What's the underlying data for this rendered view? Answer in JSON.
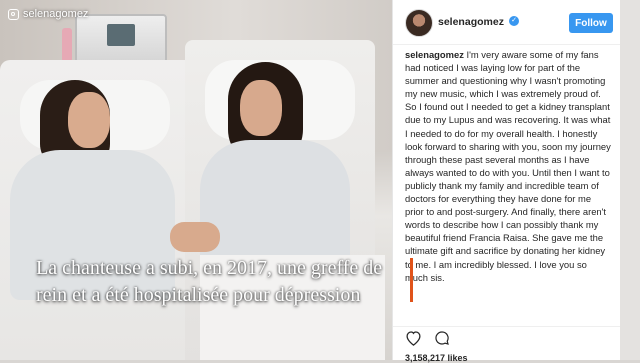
{
  "photo": {
    "handle": "selenagomez",
    "handle_icon": "instagram-icon"
  },
  "post": {
    "username": "selenagomez",
    "follow_label": "Follow",
    "caption_username": "selenagomez",
    "caption_text": " I'm very aware some of my fans had noticed I was laying low for part of the summer and questioning why I wasn't promoting my new music, which I was extremely proud of. So I found out I needed to get a kidney transplant due to my Lupus and was recovering. It was what I needed to do for my overall health. I honestly look forward to sharing with you, soon my journey through these past several months as I have always wanted to do with you. Until then I want to publicly thank my family and incredible team of doctors for everything they have done for me prior to and post-surgery. And finally, there aren't words to describe how I can possibly thank my beautiful friend Francia Raisa. She gave me the ultimate gift and sacrifice by donating her kidney to me. I am incredibly blessed. I love you so much sis.",
    "likes": "3,158,217 likes",
    "icons": [
      "heart-icon",
      "comment-icon"
    ],
    "accent": "#3897f0"
  },
  "overlay": {
    "line1": "La chanteuse a subi, en 2017, une greffe de",
    "line2": "rein et a été hospitalisée pour dépression",
    "accent": "#e0531a"
  }
}
